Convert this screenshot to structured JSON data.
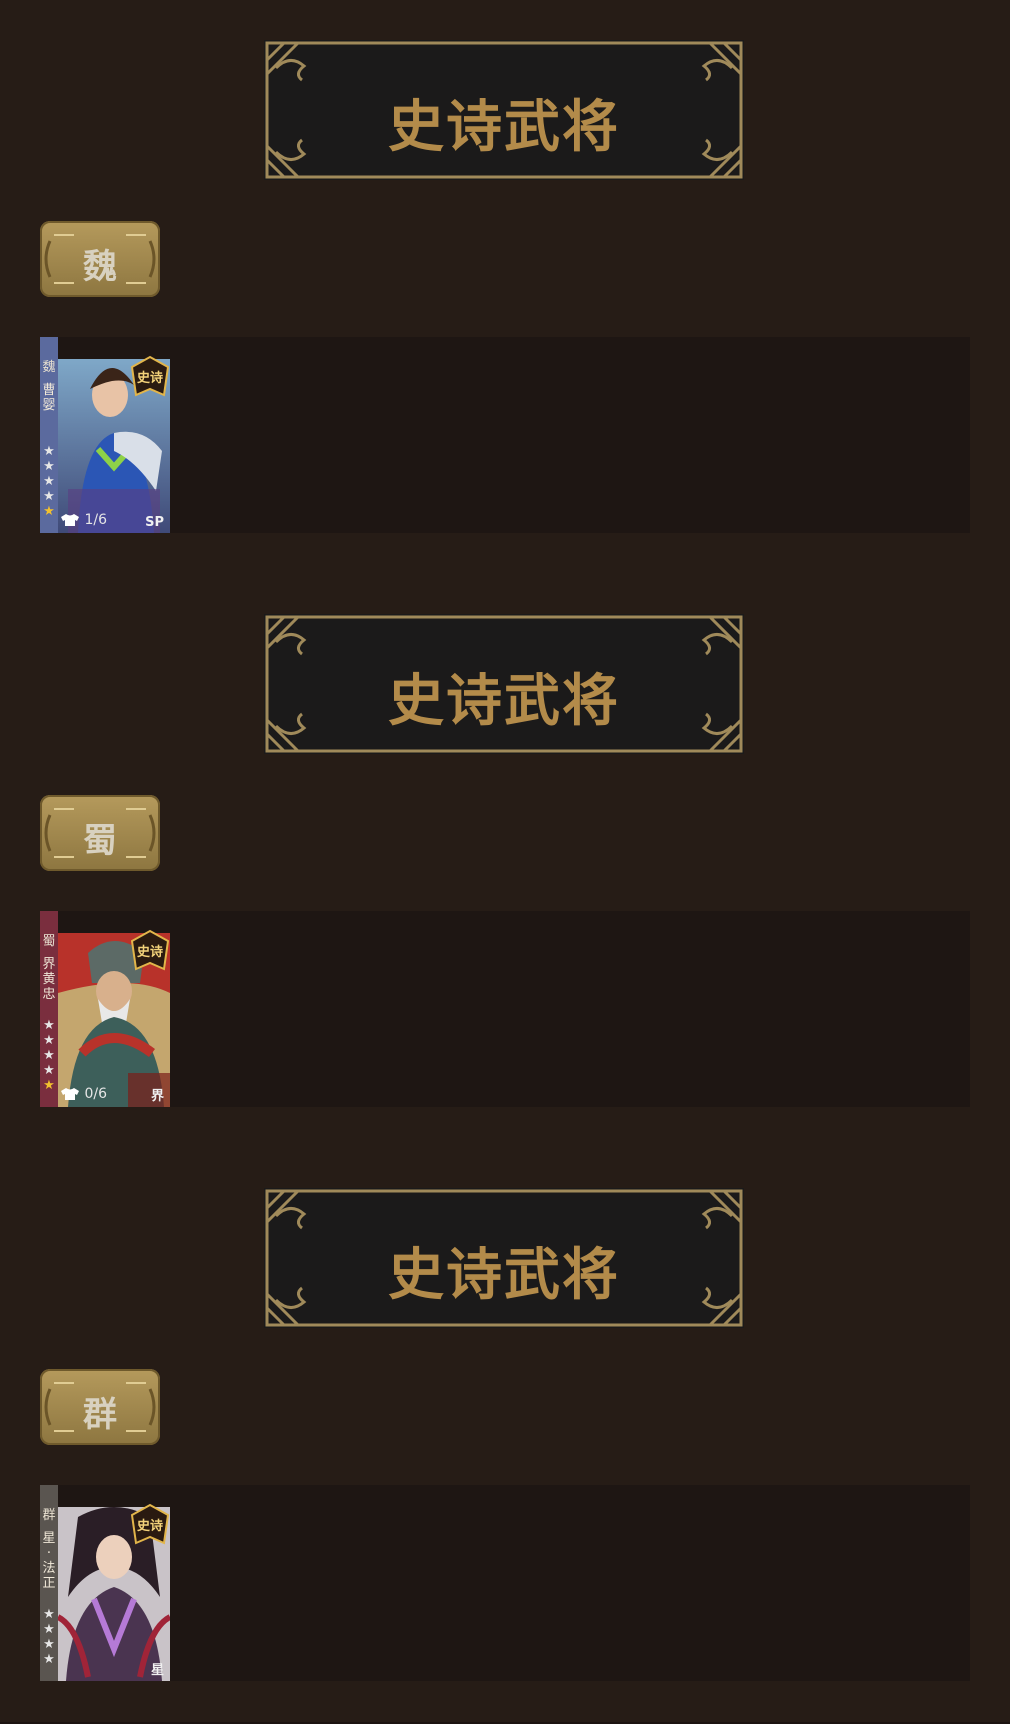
{
  "sections": [
    {
      "title": "史诗武将",
      "faction": "魏",
      "hero": {
        "faction_mark": "魏",
        "name": "曹婴",
        "epic_tag": "史诗",
        "skin_count": "1/6",
        "type_badge": "SP",
        "stars_total": 5,
        "stars_gold": 1
      }
    },
    {
      "title": "史诗武将",
      "faction": "蜀",
      "hero": {
        "faction_mark": "蜀",
        "name": "界黄忠",
        "epic_tag": "史诗",
        "skin_count": "0/6",
        "type_badge": "界",
        "stars_total": 5,
        "stars_gold": 1
      }
    },
    {
      "title": "史诗武将",
      "faction": "群",
      "hero": {
        "faction_mark": "群",
        "name": "星·法正",
        "epic_tag": "史诗",
        "skin_count": "",
        "type_badge": "星",
        "stars_total": 4,
        "stars_gold": 0
      }
    }
  ],
  "colors": {
    "page_bg": "#23191a",
    "section_bg": "#261c16",
    "title_gold": "#b38b4a",
    "frame_gold": "#a08a5a",
    "row_bg": "#1e1613"
  },
  "icons": {
    "skin": "shirt-icon",
    "star": "star-icon",
    "epic": "epic-badge-icon"
  }
}
